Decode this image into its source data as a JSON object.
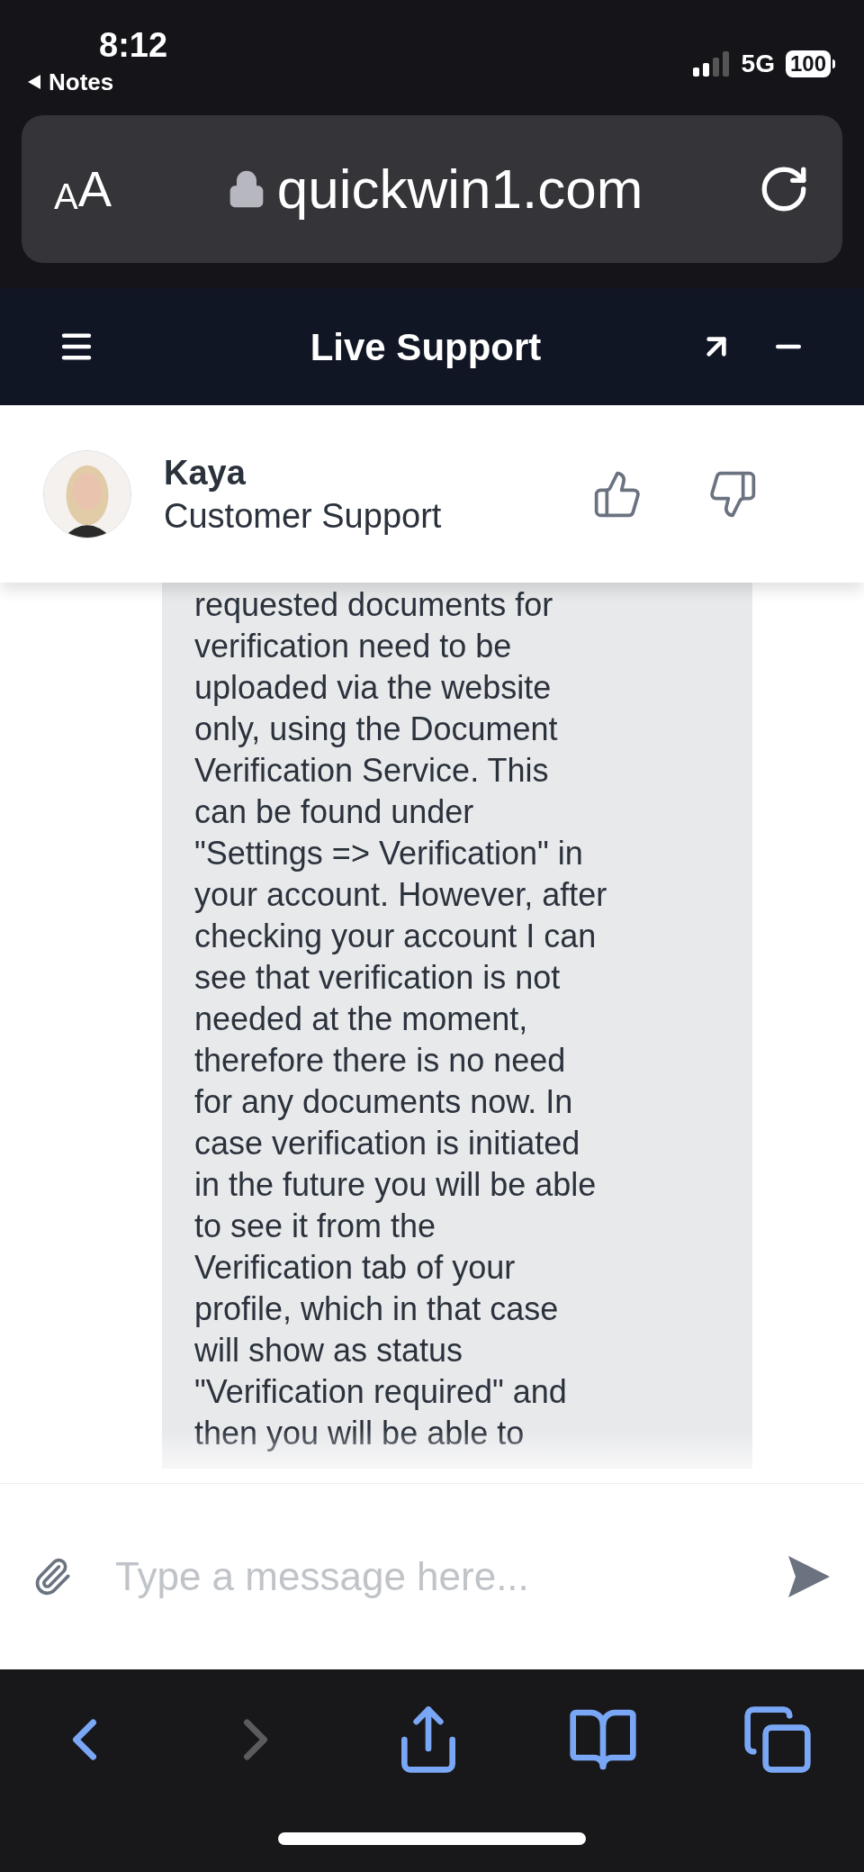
{
  "status_bar": {
    "time": "8:12",
    "back_app": "Notes",
    "network": "5G",
    "battery": "100"
  },
  "browser": {
    "text_size_label": "AA",
    "url": "quickwin1.com"
  },
  "chat": {
    "title": "Live Support",
    "agent": {
      "name": "Kaya",
      "role": "Customer Support"
    },
    "message": {
      "lines": [
        "requested documents for",
        "verification need to be",
        "uploaded via the website",
        "only, using the Document",
        "Verification Service. This",
        "can be found under",
        "\"Settings => Verification\" in",
        "your account. However, after",
        "checking your account I can",
        "see that verification is not",
        "needed at the moment,",
        "therefore there is no need",
        "for any documents now. In",
        "case verification is initiated",
        "in the future you will be able",
        "to see it from the",
        "Verification tab of your",
        "profile, which in that case",
        "will show as status",
        "\"Verification required\" and",
        "then you will be able to"
      ]
    },
    "input": {
      "placeholder": "Type a message here..."
    }
  }
}
